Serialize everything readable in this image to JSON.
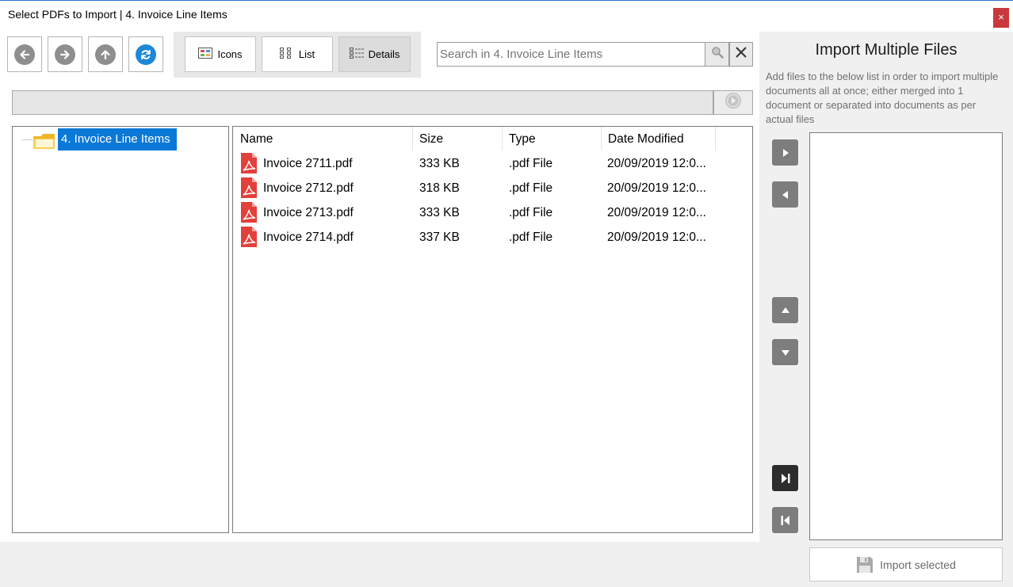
{
  "window": {
    "title": "Select PDFs to Import  |  4. Invoice Line Items",
    "close_label": "×"
  },
  "toolbar": {
    "back": "back-arrow-icon",
    "forward": "forward-arrow-icon",
    "up": "up-arrow-icon",
    "refresh": "refresh-icon",
    "view_icons_label": "Icons",
    "view_list_label": "List",
    "view_details_label": "Details",
    "active_view": "Details"
  },
  "search": {
    "placeholder": "Search in 4. Invoice Line Items"
  },
  "path": {
    "value": ""
  },
  "tree": {
    "items": [
      {
        "label": "4. Invoice Line Items",
        "selected": true
      }
    ]
  },
  "file_list": {
    "columns": [
      "Name",
      "Size",
      "Type",
      "Date Modified"
    ],
    "rows": [
      {
        "name": "Invoice 2711.pdf",
        "size": "333 KB",
        "type": ".pdf File",
        "date": "20/09/2019 12:0..."
      },
      {
        "name": "Invoice 2712.pdf",
        "size": "318 KB",
        "type": ".pdf File",
        "date": "20/09/2019 12:0..."
      },
      {
        "name": "Invoice 2713.pdf",
        "size": "333 KB",
        "type": ".pdf File",
        "date": "20/09/2019 12:0..."
      },
      {
        "name": "Invoice 2714.pdf",
        "size": "337 KB",
        "type": ".pdf File",
        "date": "20/09/2019 12:0..."
      }
    ]
  },
  "right_panel": {
    "title": "Import Multiple Files",
    "description": "Add files to the below list in order to import multiple documents all at once; either merged into 1 document or separated into documents as per actual files",
    "import_button_label": "Import selected"
  },
  "colors": {
    "accent": "#0a78d7",
    "close": "#c9383d",
    "pdf": "#e2403b"
  }
}
